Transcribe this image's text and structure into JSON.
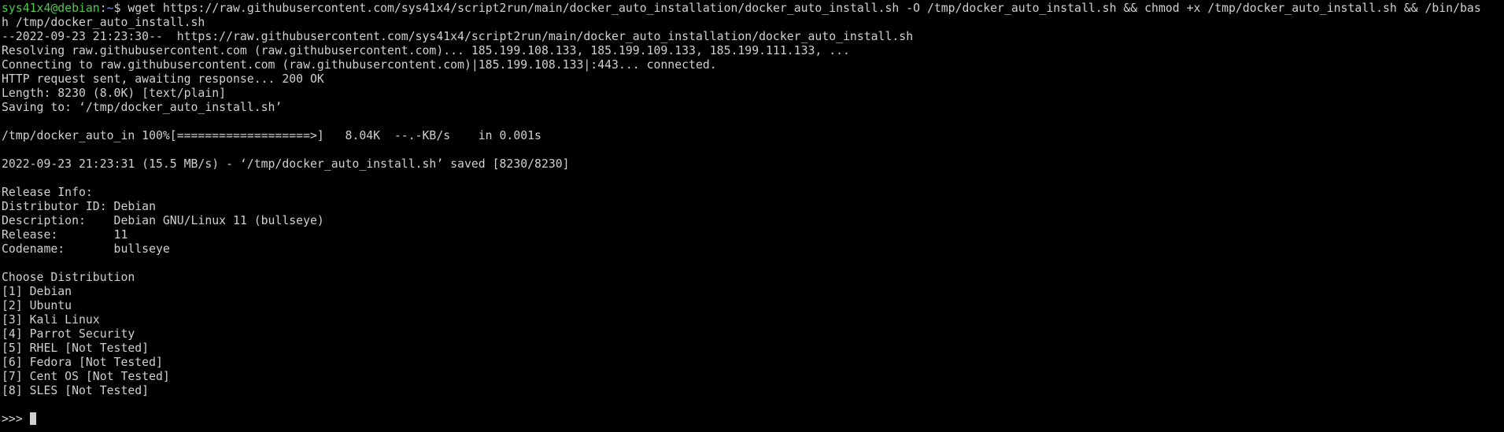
{
  "prompt": {
    "user_host": "sys41x4@debian",
    "separator": ":",
    "path": "~",
    "symbol": "$",
    "command_line1": " wget https://raw.githubusercontent.com/sys41x4/script2run/main/docker_auto_installation/docker_auto_install.sh -O /tmp/docker_auto_install.sh && chmod +x /tmp/docker_auto_install.sh && /bin/bas",
    "command_line2": "h /tmp/docker_auto_install.sh"
  },
  "output": {
    "wget_start": "--2022-09-23 21:23:30--  https://raw.githubusercontent.com/sys41x4/script2run/main/docker_auto_installation/docker_auto_install.sh",
    "resolving": "Resolving raw.githubusercontent.com (raw.githubusercontent.com)... 185.199.108.133, 185.199.109.133, 185.199.111.133, ...",
    "connecting": "Connecting to raw.githubusercontent.com (raw.githubusercontent.com)|185.199.108.133|:443... connected.",
    "http_request": "HTTP request sent, awaiting response... 200 OK",
    "length": "Length: 8230 (8.0K) [text/plain]",
    "saving_to": "Saving to: ‘/tmp/docker_auto_install.sh’",
    "progress": "/tmp/docker_auto_in 100%[===================>]   8.04K  --.-KB/s    in 0.001s",
    "saved": "2022-09-23 21:23:31 (15.5 MB/s) - ‘/tmp/docker_auto_install.sh’ saved [8230/8230]"
  },
  "release_info": {
    "header": "Release Info:",
    "distributor": "Distributor ID: Debian",
    "description": "Description:    Debian GNU/Linux 11 (bullseye)",
    "release": "Release:        11",
    "codename": "Codename:       bullseye"
  },
  "menu": {
    "header": "Choose Distribution",
    "options": [
      "[1] Debian",
      "[2] Ubuntu",
      "[3] Kali Linux",
      "[4] Parrot Security",
      "[5] RHEL [Not Tested]",
      "[6] Fedora [Not Tested]",
      "[7] Cent OS [Not Tested]",
      "[8] SLES [Not Tested]"
    ]
  },
  "input_prompt": ">>> ",
  "colors": {
    "background": "#000000",
    "text": "#d0d0d0",
    "user_host": "#4ec94e",
    "path": "#6b8fd6"
  }
}
